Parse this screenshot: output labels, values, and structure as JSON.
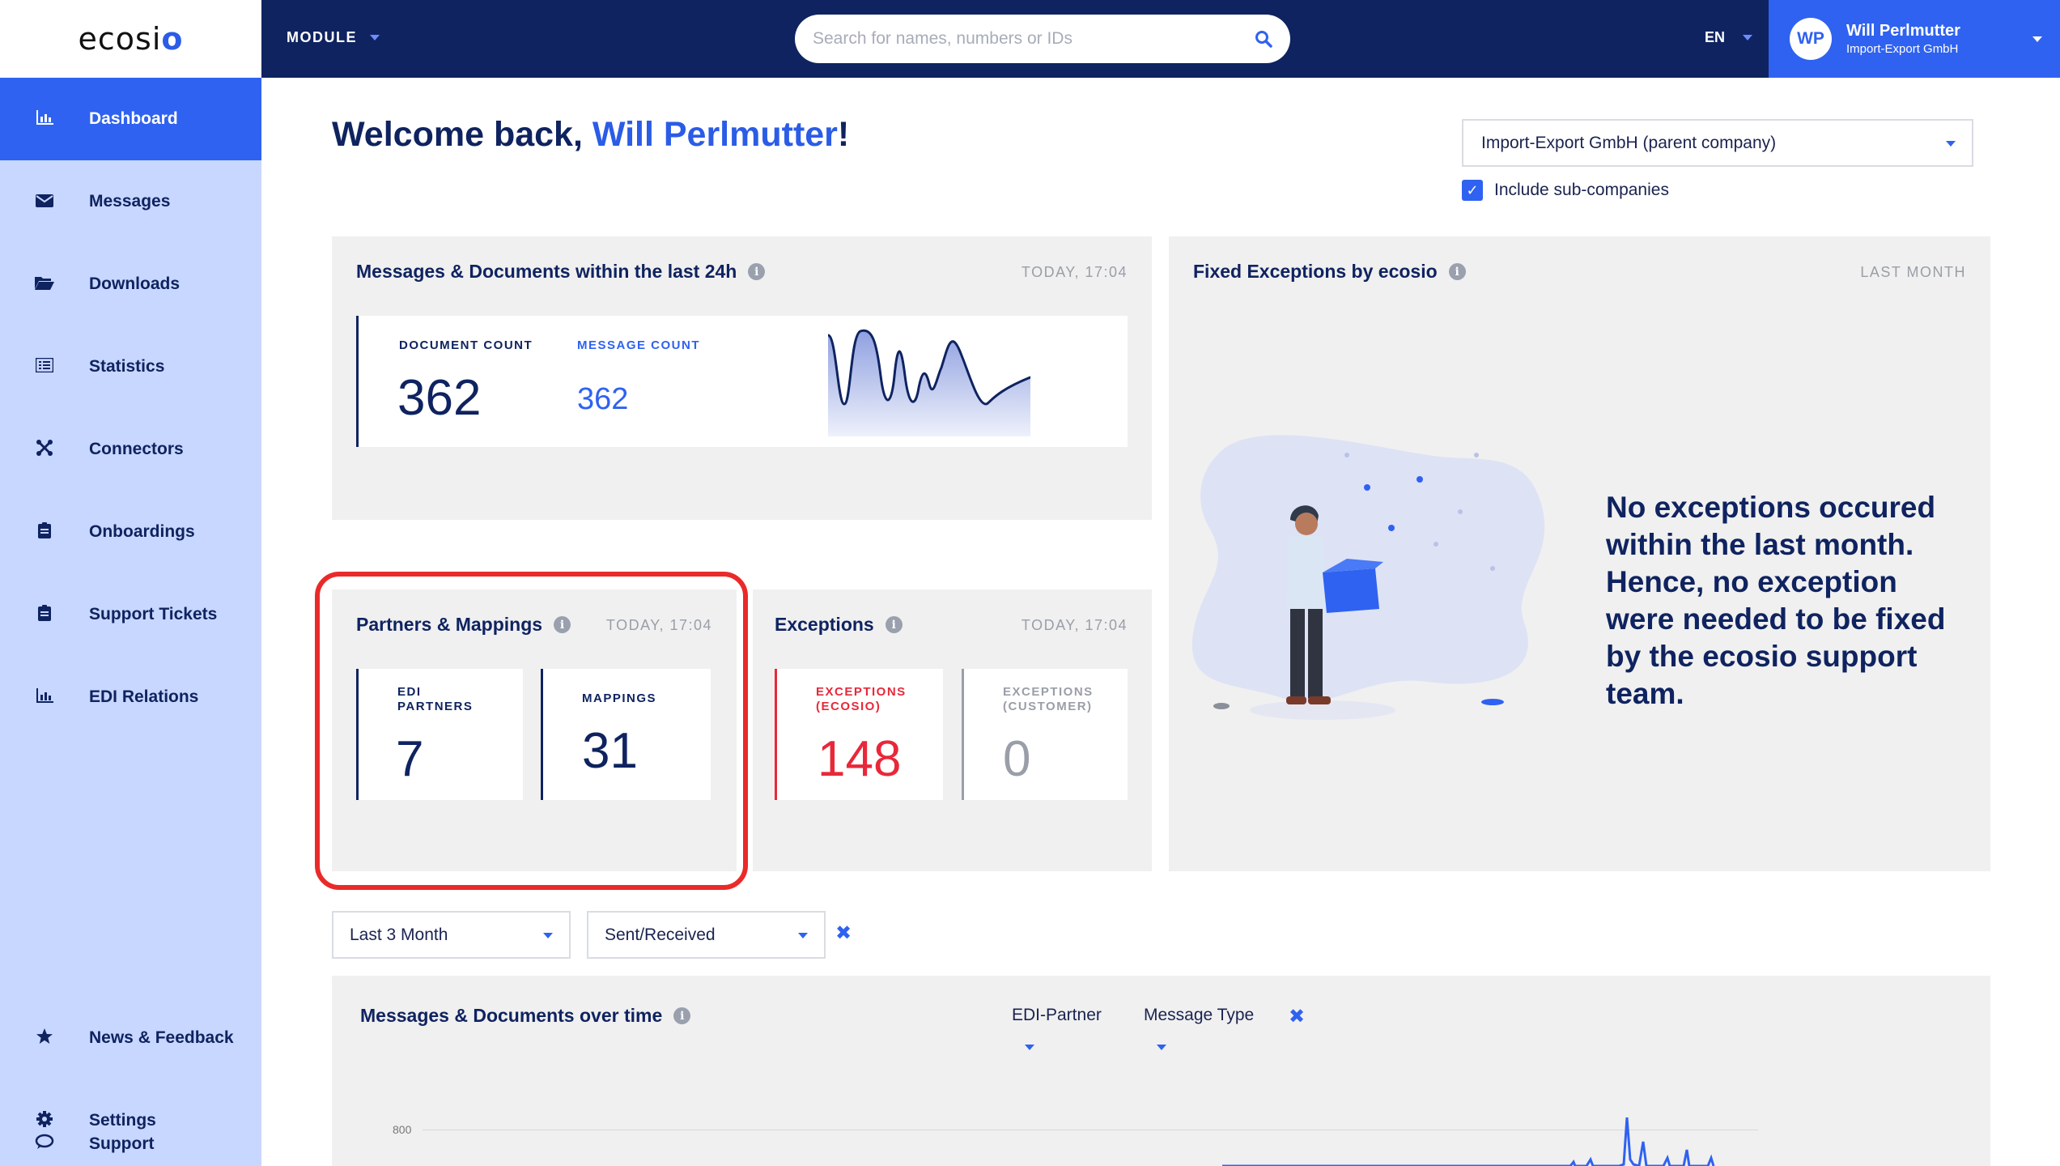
{
  "header": {
    "logo_text": "ecosio",
    "module_label": "MODULE",
    "search_placeholder": "Search for names, numbers or IDs",
    "language": "EN",
    "user": {
      "initials": "WP",
      "name": "Will Perlmutter",
      "company": "Import-Export GmbH"
    }
  },
  "sidebar": {
    "items": [
      {
        "label": "Dashboard",
        "icon": "bar-chart-icon"
      },
      {
        "label": "Messages",
        "icon": "envelope-icon"
      },
      {
        "label": "Downloads",
        "icon": "folder-icon"
      },
      {
        "label": "Statistics",
        "icon": "list-icon"
      },
      {
        "label": "Connectors",
        "icon": "connectors-icon"
      },
      {
        "label": "Onboardings",
        "icon": "clipboard-icon"
      },
      {
        "label": "Support Tickets",
        "icon": "ticket-icon"
      },
      {
        "label": "EDI Relations",
        "icon": "bar-chart-icon"
      },
      {
        "label": "News & Feedback",
        "icon": "star-icon"
      },
      {
        "label": "Settings",
        "icon": "gear-icon"
      },
      {
        "label": "Support",
        "icon": "chat-icon"
      }
    ]
  },
  "main": {
    "welcome_prefix": "Welcome back, ",
    "welcome_name": "Will Perlmutter",
    "welcome_suffix": "!",
    "company_select": "Import-Export GmbH (parent company)",
    "include_subcompanies": "Include sub-companies"
  },
  "cards": {
    "messages_24h": {
      "title": "Messages & Documents within the last 24h",
      "time": "TODAY, 17:04",
      "document_count_label": "DOCUMENT COUNT",
      "document_count": "362",
      "message_count_label": "MESSAGE COUNT",
      "message_count": "362"
    },
    "partners": {
      "title": "Partners & Mappings",
      "time": "TODAY, 17:04",
      "edi_label_1": "EDI",
      "edi_label_2": "PARTNERS",
      "edi_value": "7",
      "mappings_label": "MAPPINGS",
      "mappings_value": "31"
    },
    "exceptions": {
      "title": "Exceptions",
      "time": "TODAY, 17:04",
      "ecosio_label_1": "EXCEPTIONS",
      "ecosio_label_2": "(ECOSIO)",
      "ecosio_value": "148",
      "customer_label_1": "EXCEPTIONS",
      "customer_label_2": "(CUSTOMER)",
      "customer_value": "0"
    },
    "fixed": {
      "title": "Fixed Exceptions by ecosio",
      "time": "LAST MONTH",
      "message": "No exceptions occured within the last month. Hence, no exception were needed to be fixed by the ecosio support team."
    },
    "over_time": {
      "title": "Messages & Documents over time",
      "filter_partner": "EDI-Partner",
      "filter_type": "Message Type",
      "y_tick": "800"
    }
  },
  "filters": {
    "period": "Last 3 Month",
    "direction": "Sent/Received"
  },
  "colors": {
    "navy": "#0f2360",
    "accent": "#2f62f0",
    "sidebar_bg": "#c8d7ff",
    "exception_red": "#e8283a",
    "highlight_red": "#ea2a2a"
  }
}
